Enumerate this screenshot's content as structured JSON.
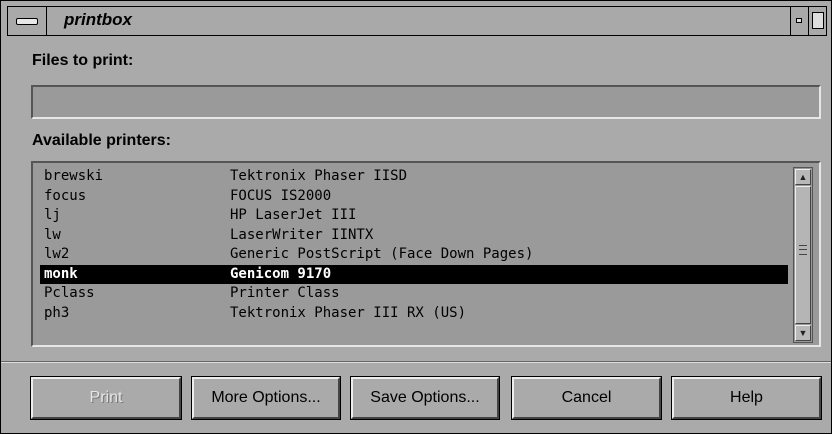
{
  "window": {
    "title": "printbox"
  },
  "files": {
    "label": "Files to print:",
    "value": ""
  },
  "printers": {
    "label": "Available printers:",
    "items": [
      {
        "name": "brewski",
        "description": "Tektronix Phaser IISD",
        "selected": false
      },
      {
        "name": "focus",
        "description": "FOCUS IS2000",
        "selected": false
      },
      {
        "name": "lj",
        "description": "HP LaserJet III",
        "selected": false
      },
      {
        "name": "lw",
        "description": "LaserWriter IINTX",
        "selected": false
      },
      {
        "name": "lw2",
        "description": "Generic PostScript (Face Down Pages)",
        "selected": false
      },
      {
        "name": "monk",
        "description": "Genicom 9170",
        "selected": true
      },
      {
        "name": "Pclass",
        "description": "Printer Class",
        "selected": false
      },
      {
        "name": "ph3",
        "description": "Tektronix Phaser III RX (US)",
        "selected": false
      }
    ],
    "scroll_position": 0
  },
  "buttons": {
    "print": {
      "label": "Print",
      "enabled": false
    },
    "more_options": {
      "label": "More Options..."
    },
    "save_options": {
      "label": "Save Options..."
    },
    "cancel": {
      "label": "Cancel"
    },
    "help": {
      "label": "Help"
    }
  },
  "icons": {
    "window_menu": "window-menu-icon",
    "minimize": "minimize-icon",
    "maximize": "maximize-icon",
    "scroll_up": "arrow-up-icon",
    "scroll_down": "arrow-down-icon"
  },
  "colors": {
    "background": "#aaaaaa",
    "field": "#9a9a9a",
    "selection": "#000000",
    "selection_text": "#ffffff"
  }
}
